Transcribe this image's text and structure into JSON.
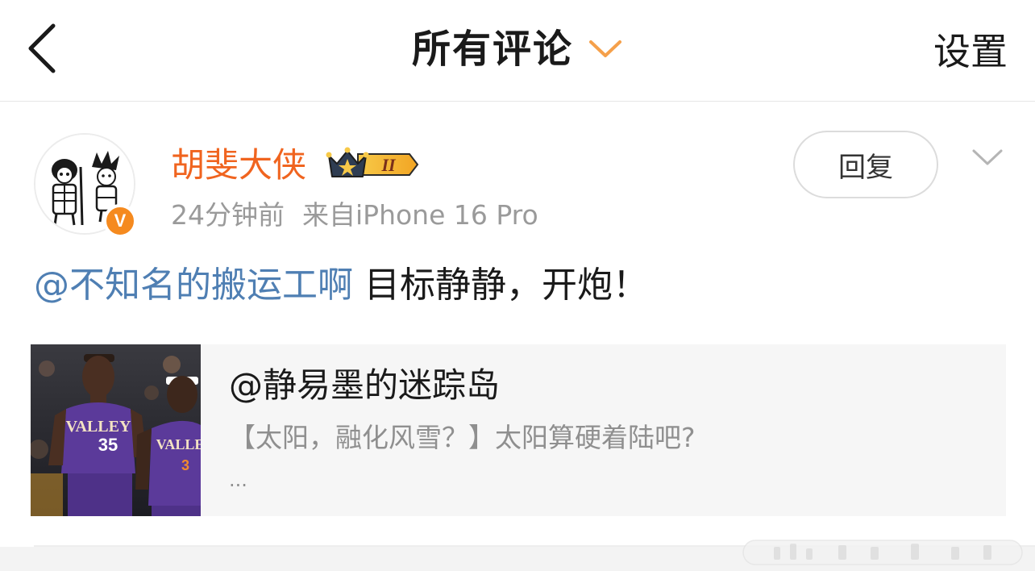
{
  "header": {
    "title": "所有评论",
    "settings_label": "设置"
  },
  "comment": {
    "username": "胡斐大侠",
    "vip_level": "II",
    "verified_mark": "V",
    "time_ago": "24分钟前",
    "source": "来自iPhone 16 Pro",
    "reply_label": "回复",
    "mention": "@不知名的搬运工啊",
    "text": " 目标静静，开炮！"
  },
  "quote": {
    "author": "@静易墨的迷踪岛",
    "snippet": "【太阳，融化风雪？】太阳算硬着陆吧?",
    "ellipsis": "...",
    "jersey_numbers": [
      "35",
      "3"
    ],
    "jersey_text": "VALLEY"
  },
  "colors": {
    "username": "#f0641f",
    "mention": "#4f7fb3",
    "accent_orange": "#f5a04a",
    "verified": "#f58a1f",
    "jersey_purple": "#5b3a9a"
  },
  "icons": {
    "back": "back-arrow-icon",
    "dropdown": "chevron-down-icon",
    "more": "chevron-down-icon",
    "vip": "crown-icon",
    "verified": "verified-v-icon"
  }
}
